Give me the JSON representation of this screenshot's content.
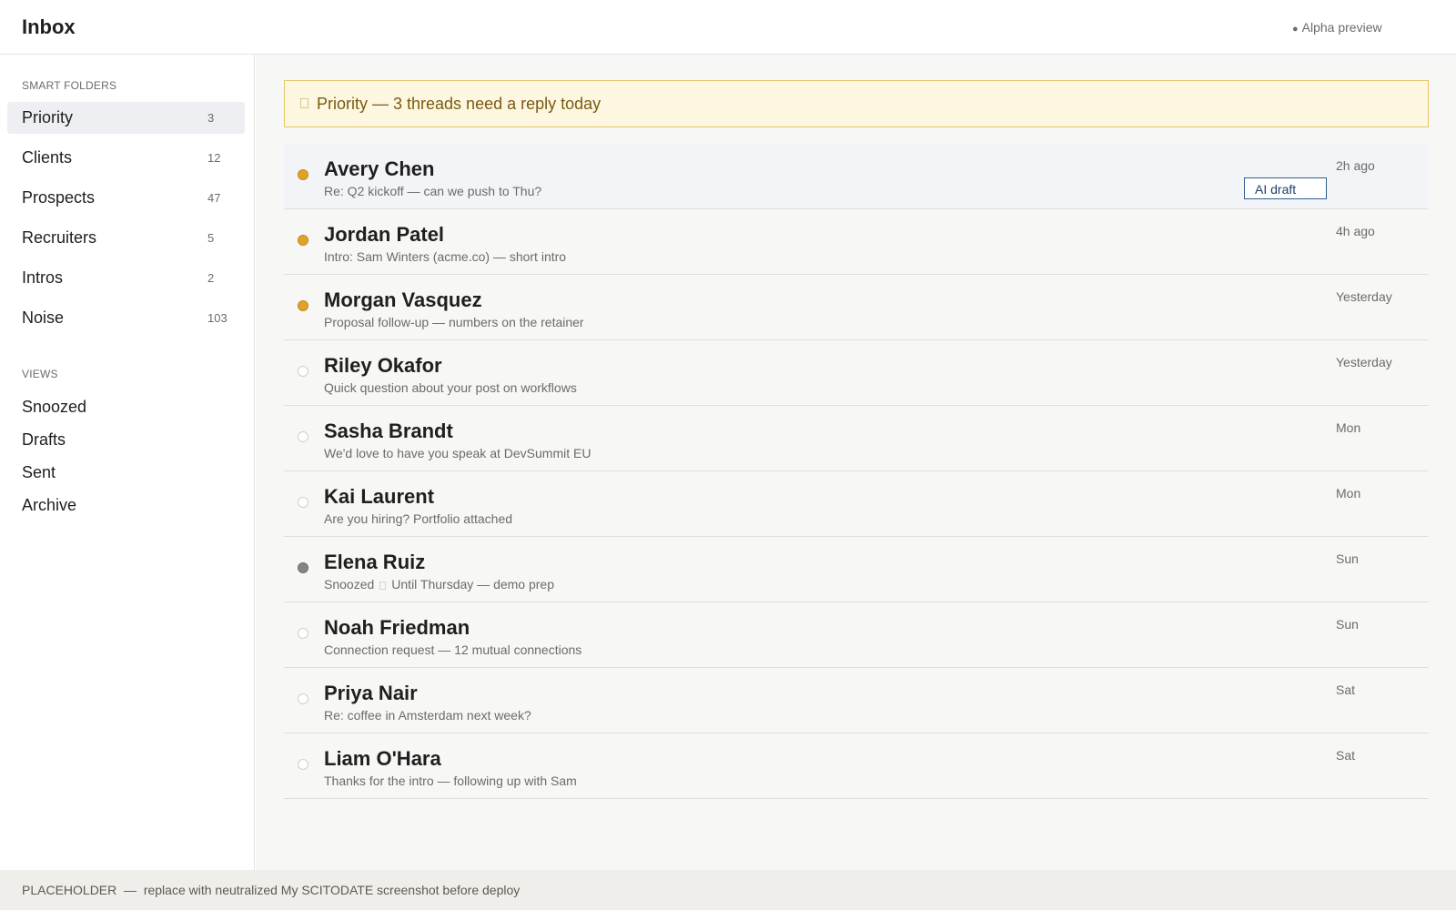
{
  "header": {
    "title": "Inbox",
    "badge": "Alpha preview"
  },
  "sidebar": {
    "smart_folders_title": "SMART FOLDERS",
    "folders": [
      {
        "label": "Priority",
        "count": "3"
      },
      {
        "label": "Clients",
        "count": "12"
      },
      {
        "label": "Prospects",
        "count": "47"
      },
      {
        "label": "Recruiters",
        "count": "5"
      },
      {
        "label": "Intros",
        "count": "2"
      },
      {
        "label": "Noise",
        "count": "103"
      }
    ],
    "active_folder": "Priority",
    "views_title": "VIEWS",
    "views": [
      "Snoozed",
      "Drafts",
      "Sent",
      "Archive"
    ]
  },
  "banner": {
    "text": "Priority — 3 threads need a reply today"
  },
  "threads": [
    {
      "name": "Avery Chen",
      "preview": "Re: Q2 kickoff — can we push to Thu?",
      "time": "2h ago",
      "status": "unread",
      "ai_draft": "AI draft"
    },
    {
      "name": "Jordan Patel",
      "preview": "Intro: Sam Winters (acme.co) — short intro",
      "time": "4h ago",
      "status": "unread"
    },
    {
      "name": "Morgan Vasquez",
      "preview": "Proposal follow-up — numbers on the retainer",
      "time": "Yesterday",
      "status": "unread"
    },
    {
      "name": "Riley Okafor",
      "preview": "Quick question about your post on workflows",
      "time": "Yesterday",
      "status": "read"
    },
    {
      "name": "Sasha Brandt",
      "preview": "We'd love to have you speak at DevSummit EU",
      "time": "Mon",
      "status": "read"
    },
    {
      "name": "Kai Laurent",
      "preview": "Are you hiring? Portfolio attached",
      "time": "Mon",
      "status": "read"
    },
    {
      "name": "Elena Ruiz",
      "preview_prefix": "Snoozed",
      "preview": "Until Thursday — demo prep",
      "time": "Sun",
      "status": "snoozed"
    },
    {
      "name": "Noah Friedman",
      "preview": "Connection request — 12 mutual connections",
      "time": "Sun",
      "status": "read"
    },
    {
      "name": "Priya Nair",
      "preview": "Re: coffee in Amsterdam next week?",
      "time": "Sat",
      "status": "read"
    },
    {
      "name": "Liam O'Hara",
      "preview": "Thanks for the intro — following up with Sam",
      "time": "Sat",
      "status": "read"
    }
  ],
  "footer": {
    "text": "PLACEHOLDER  —  replace with neutralized My SCITODATE screenshot before deploy"
  },
  "colors": {
    "unread_marker": "#e0a22a",
    "snoozed_marker": "#858585",
    "banner_bg": "#fdf7e1",
    "banner_border": "#e3c76a",
    "ai_draft_border": "#2e5d8e"
  }
}
